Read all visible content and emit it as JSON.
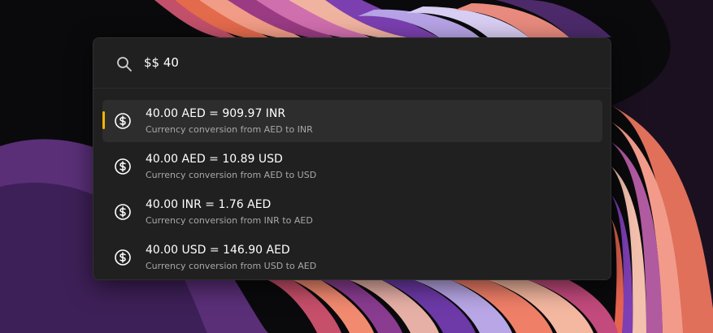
{
  "search": {
    "value": "$$ 40"
  },
  "results": [
    {
      "title": "40.00 AED = 909.97 INR",
      "subtitle": "Currency conversion from AED to INR",
      "selected": true
    },
    {
      "title": "40.00 AED = 10.89 USD",
      "subtitle": "Currency conversion from AED to USD",
      "selected": false
    },
    {
      "title": "40.00 INR = 1.76 AED",
      "subtitle": "Currency conversion from INR to AED",
      "selected": false
    },
    {
      "title": "40.00 USD = 146.90 AED",
      "subtitle": "Currency conversion from USD to AED",
      "selected": false
    }
  ],
  "icons": {
    "search": "search-icon",
    "result": "currency-icon"
  },
  "colors": {
    "accent": "#f2b600",
    "panel": "#202020",
    "selected_row": "#2d2d2d"
  }
}
